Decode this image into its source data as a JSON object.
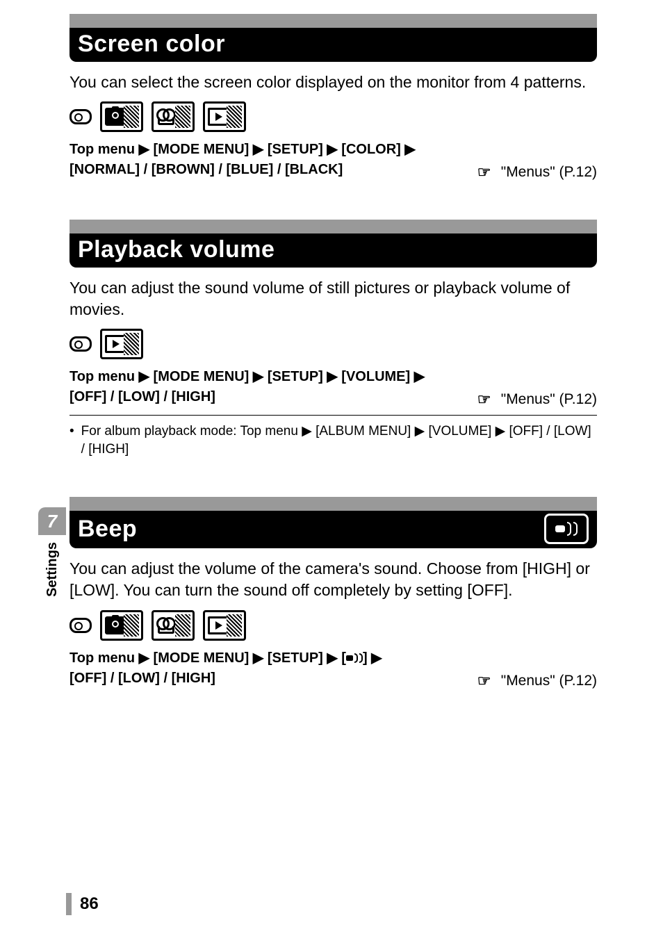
{
  "page_number": "86",
  "side_tab": {
    "chapter_number": "7",
    "label": "Settings"
  },
  "sections": {
    "screen_color": {
      "title": "Screen color",
      "description": "You can select the screen color displayed on the monitor from 4 patterns.",
      "menu_path_line1": "Top menu ▶ [MODE MENU] ▶ [SETUP] ▶ [COLOR] ▶",
      "menu_path_line2": "[NORMAL] / [BROWN] / [BLUE] / [BLACK]",
      "reference": "\"Menus\" (P.12)"
    },
    "playback_volume": {
      "title": "Playback volume",
      "description": "You can adjust the sound volume of still pictures or playback volume of movies.",
      "menu_path_line1": "Top menu ▶ [MODE MENU] ▶ [SETUP] ▶ [VOLUME] ▶",
      "menu_path_line2": "[OFF] / [LOW] / [HIGH]",
      "reference": "\"Menus\" (P.12)",
      "note": "For album playback mode: Top menu ▶ [ALBUM MENU] ▶ [VOLUME] ▶ [OFF] / [LOW] / [HIGH]"
    },
    "beep": {
      "title": "Beep",
      "description": "You can adjust the volume of the camera's sound. Choose from [HIGH] or [LOW]. You can turn the sound off completely by setting [OFF].",
      "menu_path_prefix": "Top menu ▶ [MODE MENU] ▶ [SETUP] ▶ [",
      "menu_path_suffix": "] ▶",
      "menu_path_line2": "[OFF] / [LOW] / [HIGH]",
      "reference": "\"Menus\" (P.12)"
    }
  }
}
